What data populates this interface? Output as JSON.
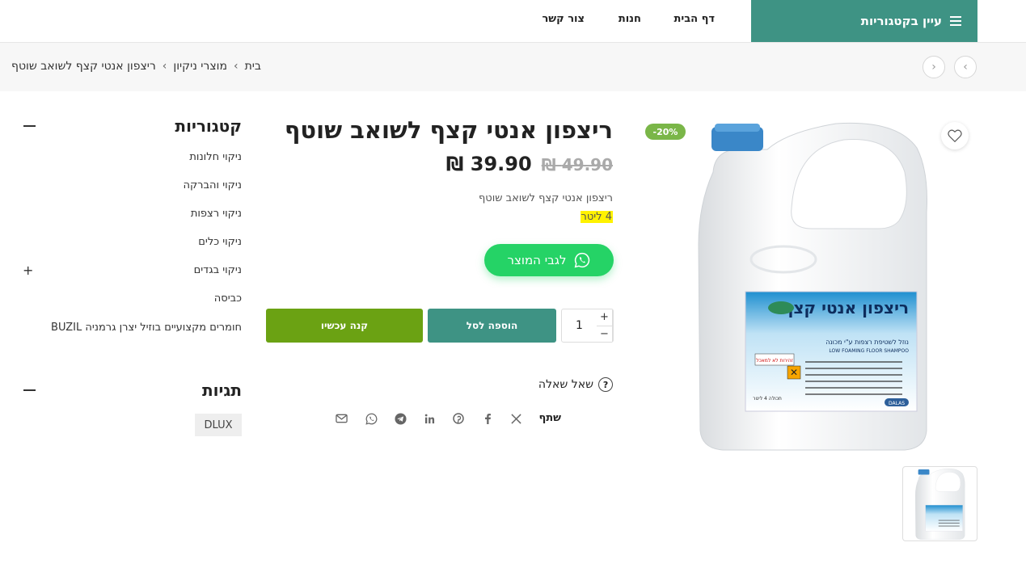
{
  "header": {
    "categories_button": "עיין בקטגוריות",
    "nav": [
      "דף הבית",
      "חנות",
      "צור קשר"
    ]
  },
  "breadcrumb": {
    "items": [
      "בית",
      "מוצרי ניקיון",
      "ריצפון אנטי קצף לשואב שוטף"
    ],
    "separator": "›"
  },
  "product": {
    "title": "ריצפון אנטי קצף לשואב שוטף",
    "price_new": "39.90 ₪",
    "price_old": "49.90 ₪",
    "discount_badge": "-20%",
    "description_line1": "ריצפון אנטי קצף לשואב שוטף",
    "description_line2": "4 ליטר",
    "whatsapp_button": "לגבי המוצר",
    "quantity": "1",
    "add_to_cart": "הוספה לסל",
    "buy_now": "קנה עכשיו",
    "ask_question": "שאל שאלה",
    "share_label": "שתף",
    "label_art": {
      "brand_title": "ריצפון אנטי קצף",
      "subtitle": "נוזל לשטיפת רצפות ע\"י מכונה",
      "subtitle_en": "LOW FOAMING FLOOR SHAMPOO",
      "warning": "זהירות לא למאכל",
      "volume": "תכולה 4 ליטר",
      "maker": "DALAS"
    }
  },
  "sidebar": {
    "categories_title": "קטגוריות",
    "categories": [
      "ניקוי חלונות",
      "ניקוי והברקה",
      "ניקוי רצפות",
      "ניקוי כלים",
      "ניקוי בגדים",
      "כביסה",
      "חומרים מקצועיים בוזיל יצרן גרמניה BUZIL"
    ],
    "tags_title": "תגיות",
    "tags": [
      "DLUX"
    ]
  },
  "colors": {
    "primary": "#3e9384",
    "buy_now": "#6ba213",
    "whatsapp": "#25d366",
    "badge": "#7ab648",
    "highlight": "#fff200"
  }
}
